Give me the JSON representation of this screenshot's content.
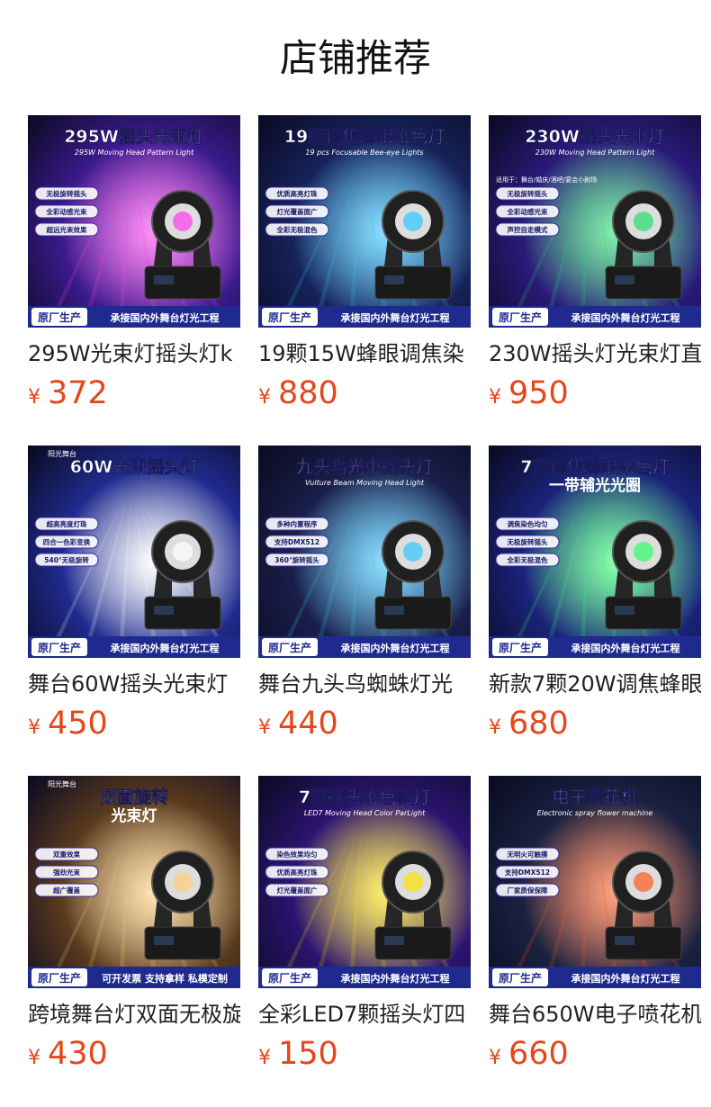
{
  "page": {
    "title": "店铺推荐"
  },
  "currency_symbol": "¥",
  "products": [
    {
      "name": "295W光束灯摇头灯k",
      "price": "372",
      "image": {
        "headline": "295W摇头光束灯",
        "subtitle": "295W Moving Head Pattern Light",
        "tags": [
          "无极旋转摇头",
          "全彩动感光束",
          "超远光束效果"
        ],
        "footer_badge": "原厂生产",
        "footer_text": "承接国内外舞台灯光工程",
        "colors": {
          "bg": "#3b1a8c",
          "accent": "#ff3df0"
        }
      }
    },
    {
      "name": "19颗15W蜂眼调焦染",
      "price": "880",
      "image": {
        "headline": "19颗调焦蜂眼染色灯",
        "subtitle": "19 pcs Focusable Bee-eye Lights",
        "tags": [
          "优质高亮灯珠",
          "灯光覆盖面广",
          "全彩无极混色"
        ],
        "footer_badge": "原厂生产",
        "footer_text": "承接国内外舞台灯光工程",
        "colors": {
          "bg": "#16225a",
          "accent": "#2ec6ff"
        }
      }
    },
    {
      "name": "230W摇头灯光束灯直",
      "price": "950",
      "image": {
        "headline": "230W摇头光束灯",
        "subtitle": "230W Moving Head Pattern Light",
        "tags": [
          "无极旋转摇头",
          "全彩动感光束",
          "声控自走模式"
        ],
        "note": "适用于：舞台/婚庆/酒吧/宴会小剧场",
        "footer_badge": "原厂生产",
        "footer_text": "承接国内外舞台灯光工程",
        "colors": {
          "bg": "#2a1a7a",
          "accent": "#23e06a"
        }
      }
    },
    {
      "name": "舞台60W摇头光束灯",
      "price": "450",
      "image": {
        "brand": "阳光舞台",
        "headline": "60W光束摇头灯",
        "tags": [
          "超高亮度灯珠",
          "四合一色彩变换",
          "540°无极旋转"
        ],
        "footer_badge": "原厂生产",
        "footer_text": "承接国内外舞台灯光工程",
        "colors": {
          "bg": "#1f2b8e",
          "accent": "#ffffff"
        }
      }
    },
    {
      "name": "舞台九头鸟蜘蛛灯光",
      "price": "440",
      "image": {
        "headline": "九头鸟光束摇头灯",
        "subtitle": "Vulture Beam Moving Head Light",
        "tags": [
          "多种内置程序",
          "支持DMX512",
          "360°旋转摇头"
        ],
        "footer_badge": "原厂生产",
        "footer_text": "承接国内外舞台灯光工程",
        "colors": {
          "bg": "#1a1f4a",
          "accent": "#35c6ff"
        }
      }
    },
    {
      "name": "新款7颗20W调焦蜂眼",
      "price": "680",
      "image": {
        "headline": "7颗调焦蜂眼染色灯",
        "headline2": "一带辅光光圈",
        "tags": [
          "调焦染色均匀",
          "无极旋转摇头",
          "全彩无极混色"
        ],
        "footer_badge": "原厂生产",
        "footer_text": "承接国内外舞台灯光工程",
        "colors": {
          "bg": "#1a237a",
          "accent": "#2cff6a"
        }
      }
    },
    {
      "name": "跨境舞台灯双面无极旋",
      "price": "430",
      "image": {
        "brand": "阳光舞台",
        "headline": "双面旋转",
        "headline2": "光束灯",
        "tags": [
          "双重效果",
          "强劲光束",
          "超广覆盖"
        ],
        "footer_badge": "原厂生产",
        "footer_text": "可开发票 支持拿样 私模定制",
        "colors": {
          "bg": "#5a3a1e",
          "accent": "#ffcf7a"
        }
      }
    },
    {
      "name": "全彩LED7颗摇头灯四",
      "price": "150",
      "image": {
        "headline": "7颗摇头染色帕灯",
        "subtitle": "LED7 Moving Head Color ParLight",
        "tags": [
          "染色效果均匀",
          "优质高亮灯珠",
          "灯光覆盖面广"
        ],
        "footer_badge": "原厂生产",
        "footer_text": "承接国内外舞台灯光工程",
        "colors": {
          "bg": "#2b1470",
          "accent": "#ffe100"
        }
      }
    },
    {
      "name": "舞台650W电子喷花机",
      "price": "660",
      "image": {
        "headline": "电子喷花机",
        "subtitle": "Electronic spray flower machine",
        "tags": [
          "无明火可触摸",
          "支持DMX512",
          "厂家质保保障"
        ],
        "footer_badge": "原厂生产",
        "footer_text": "承接国内外舞台灯光工程",
        "colors": {
          "bg": "#1a2240",
          "accent": "#ff5a1e"
        }
      }
    }
  ]
}
